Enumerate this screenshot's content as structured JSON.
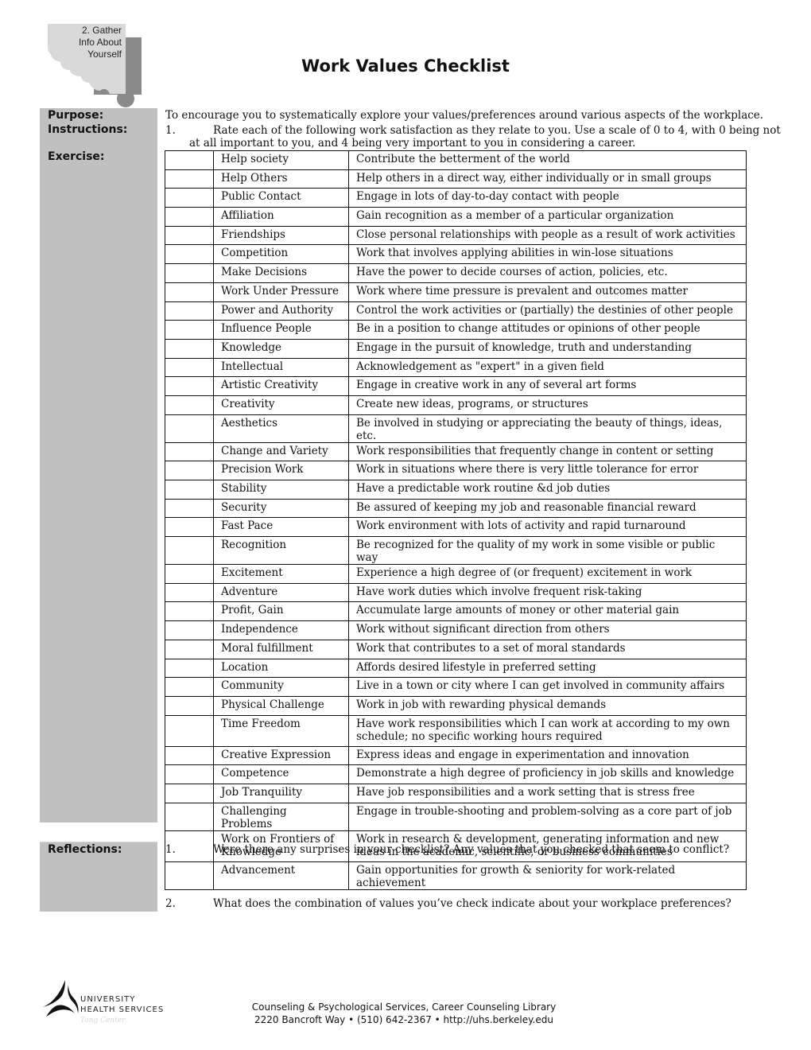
{
  "section_tab": {
    "lines": [
      "2. Gather",
      "Info About",
      "Yourself"
    ]
  },
  "title": "Work Values Checklist",
  "labels": {
    "purpose": "Purpose:",
    "instructions": "Instructions:",
    "exercise": "Exercise:",
    "reflections": "Reflections:"
  },
  "purpose_text": "To encourage you to systematically explore your values/preferences around various aspects of the workplace.",
  "instructions": {
    "number": "1.",
    "line1": "Rate each of the following work satisfaction as they relate to you.  Use a scale of 0 to 4, with 0 being not",
    "line2": "at all important to you, and 4 being very important to you in considering a career."
  },
  "values": [
    {
      "name": "Help society",
      "description": "Contribute the betterment of the world",
      "rating": ""
    },
    {
      "name": "Help Others",
      "description": "Help others in a direct way, either individually or in small groups",
      "rating": ""
    },
    {
      "name": "Public Contact",
      "description": "Engage in lots of day-to-day contact with people",
      "rating": ""
    },
    {
      "name": "Affiliation",
      "description": "Gain recognition as a member of a particular organization",
      "rating": ""
    },
    {
      "name": "Friendships",
      "description": "Close personal relationships with people as a result of work activities",
      "rating": ""
    },
    {
      "name": "Competition",
      "description": "Work that involves applying abilities in win-lose situations",
      "rating": ""
    },
    {
      "name": "Make Decisions",
      "description": "Have the power to decide courses of action, policies, etc.",
      "rating": ""
    },
    {
      "name": "Work Under Pressure",
      "description": "Work where time pressure is prevalent and outcomes matter",
      "rating": ""
    },
    {
      "name": "Power and Authority",
      "description": "Control the work activities or (partially) the destinies of other people",
      "rating": ""
    },
    {
      "name": "Influence People",
      "description": "Be in a position to change attitudes or opinions of other people",
      "rating": ""
    },
    {
      "name": "Knowledge",
      "description": "Engage in the pursuit of knowledge, truth and understanding",
      "rating": ""
    },
    {
      "name": "Intellectual",
      "description": "Acknowledgement as \"expert\" in a given field",
      "rating": ""
    },
    {
      "name": "Artistic Creativity",
      "description": "Engage in creative work in any of several art forms",
      "rating": ""
    },
    {
      "name": "Creativity",
      "description": "Create new ideas, programs, or structures",
      "rating": ""
    },
    {
      "name": "Aesthetics",
      "description": "Be involved in studying or appreciating the beauty of things, ideas, etc.",
      "rating": ""
    },
    {
      "name": "Change and Variety",
      "description": "Work responsibilities that frequently change in content or setting",
      "rating": ""
    },
    {
      "name": "Precision Work",
      "description": "Work in situations where there is very little tolerance for error",
      "rating": ""
    },
    {
      "name": "Stability",
      "description": "Have a predictable work routine &d job duties",
      "rating": ""
    },
    {
      "name": "Security",
      "description": "Be assured of keeping my job and reasonable financial reward",
      "rating": ""
    },
    {
      "name": "Fast Pace",
      "description": "Work environment with lots of activity and rapid turnaround",
      "rating": ""
    },
    {
      "name": "Recognition",
      "description": "Be recognized for the quality of my work in some visible or public way",
      "rating": ""
    },
    {
      "name": "Excitement",
      "description": "Experience a high degree of (or frequent) excitement in work",
      "rating": ""
    },
    {
      "name": "Adventure",
      "description": "Have work duties which involve frequent risk-taking",
      "rating": ""
    },
    {
      "name": "Profit, Gain",
      "description": "Accumulate large amounts of money or other material gain",
      "rating": ""
    },
    {
      "name": "Independence",
      "description": "Work without significant direction from others",
      "rating": ""
    },
    {
      "name": "Moral fulfillment",
      "description": "Work that contributes to a set of moral standards",
      "rating": ""
    },
    {
      "name": "Location",
      "description": "Affords desired lifestyle in preferred setting",
      "rating": ""
    },
    {
      "name": "Community",
      "description": "Live in a town or city where I can get involved in community affairs",
      "rating": ""
    },
    {
      "name": "Physical Challenge",
      "description": "Work in job with rewarding physical demands",
      "rating": ""
    },
    {
      "name": "Time Freedom",
      "description": "Have work responsibilities which I can work at according to my own schedule; no specific working hours required",
      "rating": ""
    },
    {
      "name": "Creative Expression",
      "description": "Express ideas and engage in experimentation and innovation",
      "rating": ""
    },
    {
      "name": "Competence",
      "description": "Demonstrate a high degree of proficiency in job skills and knowledge",
      "rating": ""
    },
    {
      "name": "Job Tranquility",
      "description": "Have job responsibilities and a work setting that is stress free",
      "rating": ""
    },
    {
      "name": "Challenging Problems",
      "description": "Engage in trouble-shooting and problem-solving as a core part of job",
      "rating": ""
    },
    {
      "name": "Work on Frontiers of Knowledge",
      "description": "Work in research & development, generating information and new ideas in the academic, scientific, or business communities",
      "rating": ""
    },
    {
      "name": "Advancement",
      "description": "Gain opportunities for growth & seniority for work-related achievement",
      "rating": ""
    }
  ],
  "reflections": [
    {
      "number": "1.",
      "text": "Were there any surprises in your checklist?  Any values that you checked that seem to conflict?"
    },
    {
      "number": "2.",
      "text": "What does the combination of values you’ve check indicate about your workplace preferences?"
    }
  ],
  "footer": {
    "logo_line1": "UNIVERSITY",
    "logo_line2": "HEALTH SERVICES",
    "logo_sub": "Tang Center",
    "line1": "Counseling & Psychological Services, Career Counseling Library",
    "line2": "2220 Bancroft Way •  (510) 642-2367 • http://uhs.berkeley.edu"
  }
}
